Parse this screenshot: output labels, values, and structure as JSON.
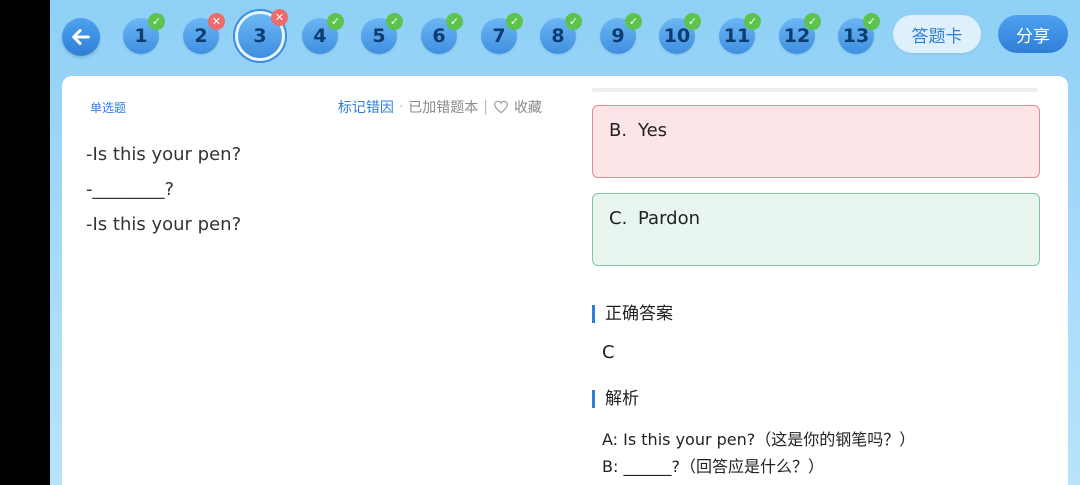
{
  "nav": {
    "questions": [
      {
        "number": "1",
        "status": "correct"
      },
      {
        "number": "2",
        "status": "wrong"
      },
      {
        "number": "3",
        "status": "wrong",
        "current": true
      },
      {
        "number": "4",
        "status": "correct"
      },
      {
        "number": "5",
        "status": "correct"
      },
      {
        "number": "6",
        "status": "correct"
      },
      {
        "number": "7",
        "status": "correct"
      },
      {
        "number": "8",
        "status": "correct"
      },
      {
        "number": "9",
        "status": "correct"
      },
      {
        "number": "10",
        "status": "correct"
      },
      {
        "number": "11",
        "status": "correct"
      },
      {
        "number": "12",
        "status": "correct"
      },
      {
        "number": "13",
        "status": "correct"
      }
    ],
    "answer_card_label": "答题卡",
    "share_label": "分享"
  },
  "question": {
    "type_label": "单选题",
    "mark_reason_label": "标记错因",
    "added_wrong_book_label": "已加错题本",
    "favorite_label": "收藏",
    "lines": [
      "-Is this your pen?",
      "-________?",
      "-Is this your pen?"
    ]
  },
  "options": [
    {
      "letter": "B.",
      "text": "Yes",
      "state": "wrong"
    },
    {
      "letter": "C.",
      "text": "Pardon",
      "state": "correct"
    }
  ],
  "correct_answer": {
    "title": "正确答案",
    "value": "C"
  },
  "analysis": {
    "title": "解析",
    "lines": [
      "A: Is this your pen?（这是你的钢笔吗？）",
      "B: ______?（回答应是什么？）"
    ]
  },
  "colors": {
    "accent": "#2f7fd6",
    "correct": "#5cc34d",
    "wrong": "#ee6b6b",
    "wrong_option_bg": "#fde4e6",
    "correct_option_bg": "#e8f6ef"
  }
}
